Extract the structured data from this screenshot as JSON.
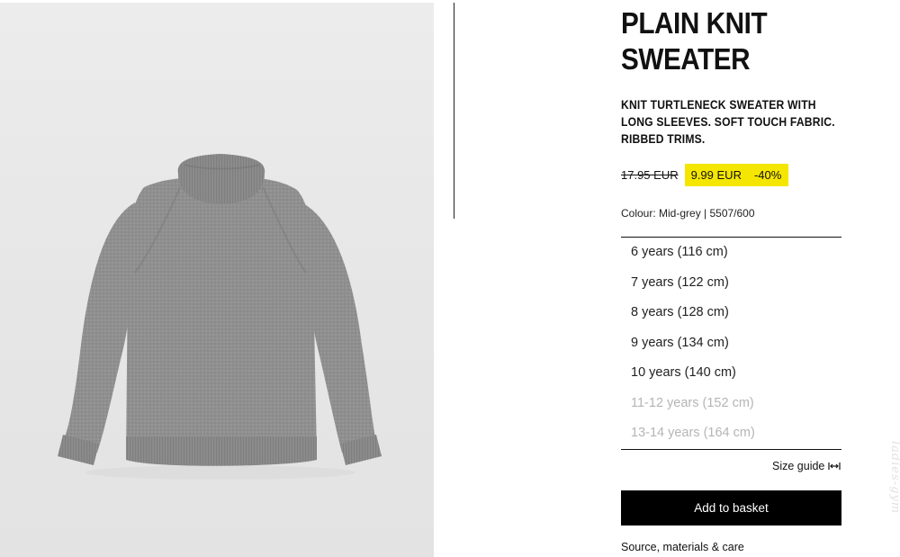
{
  "product": {
    "title": "PLAIN KNIT SWEATER",
    "description": "KNIT TURTLENECK SWEATER WITH LONG SLEEVES. SOFT TOUCH FABRIC. RIBBED TRIMS.",
    "old_price": "17.95 EUR",
    "sale_price": "9.99 EUR",
    "discount": "-40%",
    "colour_line": "Colour: Mid-grey | 5507/600",
    "sale_highlight_color": "#f5e600",
    "image_icon": "grey-turtleneck-sweater-image"
  },
  "sizes": [
    {
      "label": "6 years (116 cm)",
      "available": true
    },
    {
      "label": "7 years (122 cm)",
      "available": true
    },
    {
      "label": "8 years (128 cm)",
      "available": true
    },
    {
      "label": "9 years (134 cm)",
      "available": true
    },
    {
      "label": "10 years (140 cm)",
      "available": true
    },
    {
      "label": "11-12 years (152 cm)",
      "available": false
    },
    {
      "label": "13-14 years (164 cm)",
      "available": false
    }
  ],
  "actions": {
    "size_guide_label": "Size guide",
    "size_guide_icon": "ruler-arrows-icon",
    "add_to_basket_label": "Add to basket",
    "source_link_label": "Source, materials & care"
  },
  "watermark": "ladies-gym"
}
